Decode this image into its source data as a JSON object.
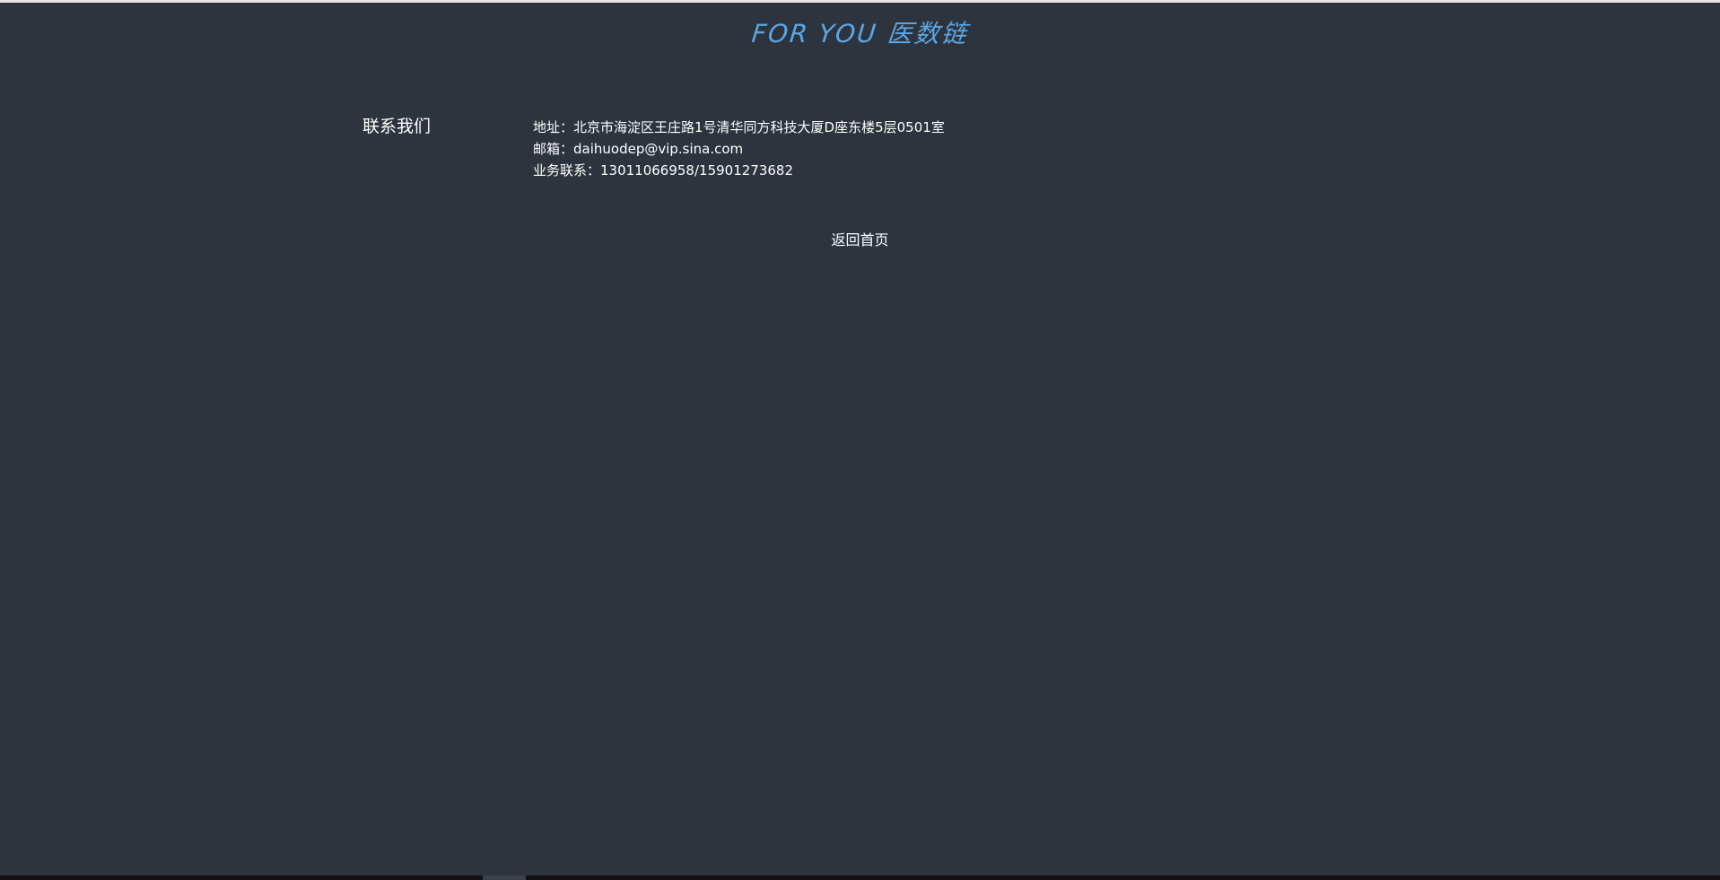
{
  "header": {
    "logo_en": "FOR YOU",
    "logo_cn": "医数链",
    "logo_color": "#5aa6e6"
  },
  "contact": {
    "title": "联系我们",
    "address": "地址：北京市海淀区王庄路1号清华同方科技大厦D座东楼5层0501室",
    "email": "邮箱：daihuodep@vip.sina.com",
    "phone": "业务联系：13011066958/15901273682"
  },
  "nav": {
    "back_home_label": "返回首页"
  },
  "colors": {
    "background": "#2d343d",
    "text": "#ffffff"
  }
}
